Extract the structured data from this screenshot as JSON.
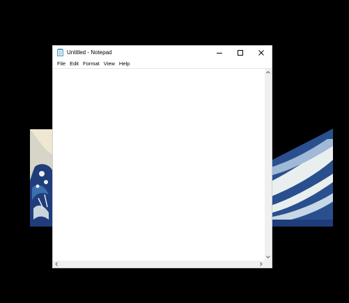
{
  "window": {
    "title": "Untitled - Notepad",
    "icon": "notepad-icon",
    "controls": [
      "minimize-icon",
      "maximize-icon",
      "close-icon"
    ]
  },
  "menu": {
    "items": [
      "File",
      "Edit",
      "Format",
      "View",
      "Help"
    ]
  },
  "editor": {
    "content": ""
  },
  "wallpaper": {
    "image": "great-wave-painting",
    "colors": {
      "background": "#000000",
      "wave_dark": "#1f3d7a",
      "wave_mid": "#3c6fae",
      "foam": "#e8efee",
      "sky": "#efe7d2"
    }
  }
}
